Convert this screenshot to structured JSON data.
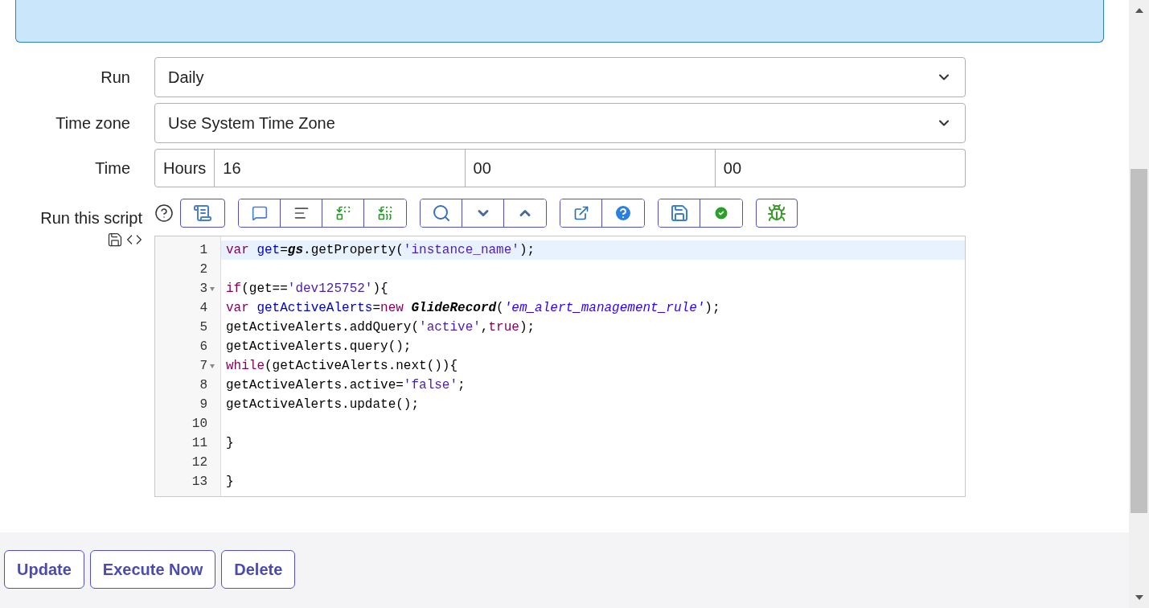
{
  "form": {
    "fields": [
      {
        "kind": "select",
        "label": "Run",
        "value": "Daily"
      },
      {
        "kind": "select",
        "label": "Time zone",
        "value": "Use System Time Zone"
      },
      {
        "kind": "time",
        "label": "Time",
        "unit": "Hours",
        "parts": [
          "16",
          "00",
          "00"
        ]
      }
    ],
    "script": {
      "label": "Run this script",
      "lines": [
        {
          "number": "1",
          "fold": false,
          "active": true,
          "tokens": [
            {
              "text": "var",
              "kind": "keyword"
            },
            {
              "text": " get",
              "kind": "def"
            },
            {
              "text": "=",
              "kind": "plain"
            },
            {
              "text": "gs",
              "kind": "builtin"
            },
            {
              "text": ".getProperty(",
              "kind": "plain"
            },
            {
              "text": "'instance_name'",
              "kind": "string"
            },
            {
              "text": ");",
              "kind": "plain"
            }
          ]
        },
        {
          "number": "2",
          "fold": false,
          "active": false
        },
        {
          "number": "3",
          "fold": true,
          "active": false,
          "tokens": [
            {
              "text": "if",
              "kind": "keyword"
            },
            {
              "text": "(get==",
              "kind": "plain"
            },
            {
              "text": "'dev125752'",
              "kind": "string"
            },
            {
              "text": "){",
              "kind": "plain"
            }
          ]
        },
        {
          "number": "4",
          "fold": false,
          "active": false,
          "tokens": [
            {
              "text": "var",
              "kind": "keyword"
            },
            {
              "text": " getActiveAlerts",
              "kind": "def"
            },
            {
              "text": "=",
              "kind": "plain"
            },
            {
              "text": "new",
              "kind": "keyword"
            },
            {
              "text": " GlideRecord",
              "kind": "builtin"
            },
            {
              "text": "(",
              "kind": "plain"
            },
            {
              "text": "'em_alert_management_rule'",
              "kind": "emstring"
            },
            {
              "text": ");",
              "kind": "plain"
            }
          ]
        },
        {
          "number": "5",
          "fold": false,
          "active": false,
          "tokens": [
            {
              "text": "getActiveAlerts.addQuery(",
              "kind": "plain"
            },
            {
              "text": "'active'",
              "kind": "string"
            },
            {
              "text": ",",
              "kind": "plain"
            },
            {
              "text": "true",
              "kind": "atom"
            },
            {
              "text": ");",
              "kind": "plain"
            }
          ]
        },
        {
          "number": "6",
          "fold": false,
          "active": false,
          "tokens": [
            {
              "text": "getActiveAlerts.query();",
              "kind": "plain"
            }
          ]
        },
        {
          "number": "7",
          "fold": true,
          "active": false,
          "tokens": [
            {
              "text": "while",
              "kind": "keyword"
            },
            {
              "text": "(getActiveAlerts.next()){",
              "kind": "plain"
            }
          ]
        },
        {
          "number": "8",
          "fold": false,
          "active": false,
          "tokens": [
            {
              "text": "getActiveAlerts.active=",
              "kind": "plain"
            },
            {
              "text": "'false'",
              "kind": "string"
            },
            {
              "text": ";",
              "kind": "plain"
            }
          ]
        },
        {
          "number": "9",
          "fold": false,
          "active": false,
          "tokens": [
            {
              "text": "getActiveAlerts.update();",
              "kind": "plain"
            }
          ]
        },
        {
          "number": "10",
          "fold": false,
          "active": false
        },
        {
          "number": "11",
          "fold": false,
          "active": false,
          "tokens": [
            {
              "text": "}",
              "kind": "plain"
            }
          ]
        },
        {
          "number": "12",
          "fold": false,
          "active": false
        },
        {
          "number": "13",
          "fold": false,
          "active": false,
          "tokens": [
            {
              "text": "}",
              "kind": "plain"
            }
          ]
        }
      ]
    }
  },
  "buttons": [
    "Update",
    "Execute Now",
    "Delete"
  ]
}
